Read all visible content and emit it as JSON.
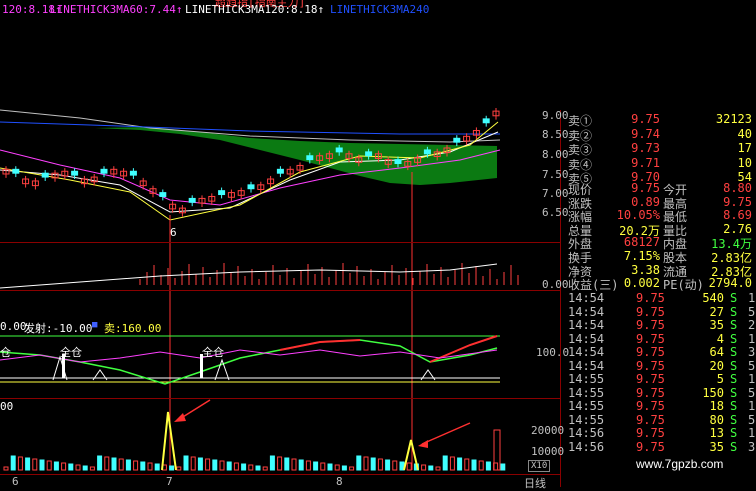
{
  "header": {
    "title_fragment": "超趋指[指南主力]",
    "ma_labels": [
      {
        "text": "120:8.18↑",
        "color": "#ff40ff"
      },
      {
        "text": "LINETHICK3MA60:7.44↑",
        "color": "#ff40ff"
      },
      {
        "text": "LINETHICK3MA120:8.18↑",
        "color": "#ffffff"
      },
      {
        "text": "LINETHICK3MA240",
        "color": "#2050ff"
      }
    ]
  },
  "price_axis": [
    "9.00",
    "8.50",
    "8.00",
    "7.50",
    "7.00",
    "6.50"
  ],
  "price_low_mark": "6",
  "vol_axis": "0.00",
  "signal_panel": {
    "left_value": "0.00",
    "fa_label": "发射:-10.00",
    "mai_label": "卖:160.00",
    "axis_100": "100.0",
    "marks": [
      "仓",
      "全仓",
      "全仓"
    ]
  },
  "bottom_panel": {
    "left_value": "00",
    "axis": [
      "20000",
      "10000"
    ],
    "x10": "X10",
    "period": "日线",
    "date_ticks": [
      "6",
      "7",
      "8"
    ]
  },
  "order_book": [
    {
      "label": "卖①",
      "price": "9.75",
      "vol": "32123"
    },
    {
      "label": "卖②",
      "price": "9.74",
      "vol": "40"
    },
    {
      "label": "卖③",
      "price": "9.73",
      "vol": "17"
    },
    {
      "label": "卖④",
      "price": "9.71",
      "vol": "10"
    },
    {
      "label": "卖⑤",
      "price": "9.70",
      "vol": "54"
    }
  ],
  "quote_stats": [
    {
      "l1": "现价",
      "v1": "9.75",
      "c1": "#ff4040",
      "l2": "今开",
      "v2": "8.80",
      "c2": "#ff4040"
    },
    {
      "l1": "涨跌",
      "v1": "0.89",
      "c1": "#ff4040",
      "l2": "最高",
      "v2": "9.75",
      "c2": "#ff4040"
    },
    {
      "l1": "涨幅",
      "v1": "10.05%",
      "c1": "#ff4040",
      "l2": "最低",
      "v2": "8.69",
      "c2": "#ff4040"
    },
    {
      "l1": "总量",
      "v1": "20.2万",
      "c1": "#ffff40",
      "l2": "量比",
      "v2": "2.76",
      "c2": "#ffff40"
    },
    {
      "l1": "外盘",
      "v1": "68127",
      "c1": "#ff4040",
      "l2": "内盘",
      "v2": "13.4万",
      "c2": "#40ff40"
    },
    {
      "l1": "换手",
      "v1": "7.15%",
      "c1": "#ffff40",
      "l2": "股本",
      "v2": "2.83亿",
      "c2": "#ffff40"
    },
    {
      "l1": "净资",
      "v1": "3.38",
      "c1": "#ffff40",
      "l2": "流通",
      "v2": "2.83亿",
      "c2": "#ffff40"
    },
    {
      "l1": "收益(三)",
      "v1": "0.002",
      "c1": "#ffff40",
      "l2": "PE(动)",
      "v2": "2794.0",
      "c2": "#ffff40"
    }
  ],
  "ticks": [
    {
      "time": "14:54",
      "price": "9.75",
      "vol": "540",
      "bs": "S",
      "n": "1"
    },
    {
      "time": "14:54",
      "price": "9.75",
      "vol": "27",
      "bs": "S",
      "n": "5"
    },
    {
      "time": "14:54",
      "price": "9.75",
      "vol": "35",
      "bs": "S",
      "n": "2"
    },
    {
      "time": "14:54",
      "price": "9.75",
      "vol": "4",
      "bs": "S",
      "n": "1"
    },
    {
      "time": "14:54",
      "price": "9.75",
      "vol": "64",
      "bs": "S",
      "n": "3"
    },
    {
      "time": "14:54",
      "price": "9.75",
      "vol": "20",
      "bs": "S",
      "n": "5"
    },
    {
      "time": "14:55",
      "price": "9.75",
      "vol": "5",
      "bs": "S",
      "n": "1"
    },
    {
      "time": "14:55",
      "price": "9.75",
      "vol": "150",
      "bs": "S",
      "n": "5"
    },
    {
      "time": "14:55",
      "price": "9.75",
      "vol": "18",
      "bs": "S",
      "n": "1"
    },
    {
      "time": "14:55",
      "price": "9.75",
      "vol": "80",
      "bs": "S",
      "n": "5"
    },
    {
      "time": "14:56",
      "price": "9.75",
      "vol": "13",
      "bs": "S",
      "n": "1"
    },
    {
      "time": "14:56",
      "price": "9.75",
      "vol": "35",
      "bs": "S",
      "n": "3"
    }
  ],
  "watermark": "www.7gpzb.com",
  "colors": {
    "up": "#ff4040",
    "down": "#40ffff",
    "grid": "#8a0000",
    "green_fill": "#0b7a12"
  }
}
